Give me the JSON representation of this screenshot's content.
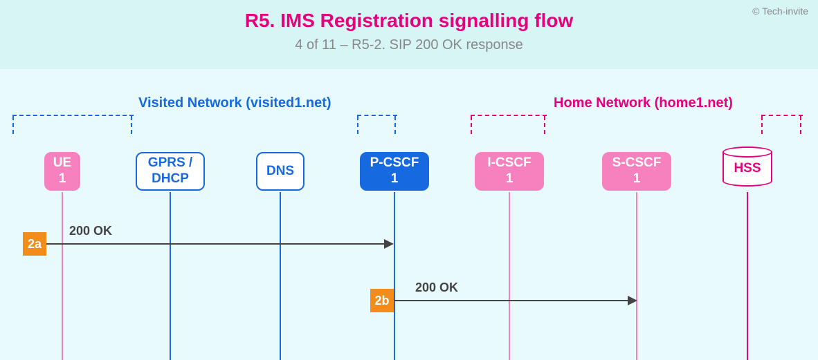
{
  "header": {
    "title": "R5. IMS Registration signalling flow",
    "subtitle": "4 of 11 – R5-2. SIP 200 OK response",
    "copyright": "© Tech-invite"
  },
  "networks": {
    "visited": {
      "label": "Visited Network (visited1.net)"
    },
    "home": {
      "label": "Home Network (home1.net)"
    }
  },
  "nodes": {
    "ue1": "UE\n1",
    "gprs": "GPRS /\nDHCP",
    "dns": "DNS",
    "pcscf1": "P-CSCF\n1",
    "icscf1": "I-CSCF\n1",
    "scscf1": "S-CSCF\n1",
    "hss": "HSS"
  },
  "messages": {
    "m2a": {
      "badge": "2a",
      "label": "200 OK"
    },
    "m2b": {
      "badge": "2b",
      "label": "200 OK"
    }
  }
}
